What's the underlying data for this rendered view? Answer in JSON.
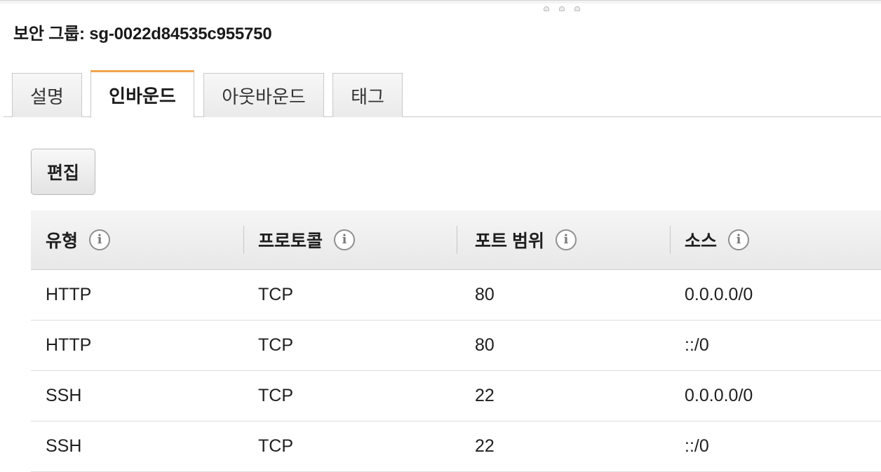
{
  "page": {
    "title": "보안 그룹: sg-0022d84535c955750"
  },
  "tabs": [
    {
      "label": "설명",
      "active": false
    },
    {
      "label": "인바운드",
      "active": true
    },
    {
      "label": "아웃바운드",
      "active": false
    },
    {
      "label": "태그",
      "active": false
    }
  ],
  "toolbar": {
    "edit_label": "편집"
  },
  "table": {
    "columns": [
      "유형",
      "프로토콜",
      "포트 범위",
      "소스"
    ],
    "rows": [
      [
        "HTTP",
        "TCP",
        "80",
        "0.0.0.0/0"
      ],
      [
        "HTTP",
        "TCP",
        "80",
        "::/0"
      ],
      [
        "SSH",
        "TCP",
        "22",
        "0.0.0.0/0"
      ],
      [
        "SSH",
        "TCP",
        "22",
        "::/0"
      ]
    ]
  },
  "icons": {
    "info": "info-icon",
    "drag_handle": "drag-handle-icon"
  },
  "colors": {
    "active_tab_accent": "#f0a44b"
  }
}
